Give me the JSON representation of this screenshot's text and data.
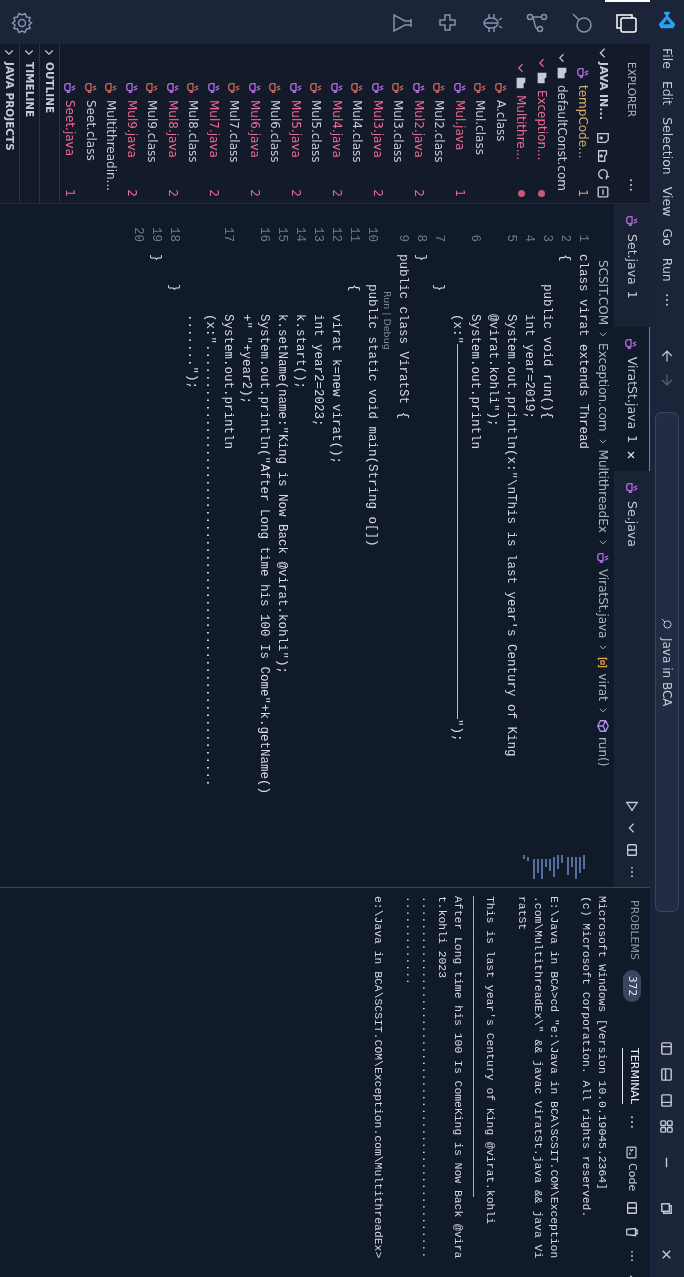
{
  "title_bar": {
    "menu": [
      "File",
      "Edit",
      "Selection",
      "View",
      "Go",
      "Run"
    ],
    "search": "Java in BCA"
  },
  "activity_bar": [
    {
      "kind": "explorer",
      "selected": true
    },
    {
      "kind": "search",
      "selected": false
    },
    {
      "kind": "source_control",
      "selected": false
    },
    {
      "kind": "debug",
      "selected": false
    },
    {
      "kind": "extensions",
      "selected": false
    },
    {
      "kind": "testing",
      "selected": false
    }
  ],
  "sidebar": {
    "title": "EXPLORER",
    "folder": "JAVA IN...",
    "items": [
      {
        "label": "tempCode...",
        "kind": "java",
        "badge": "1",
        "warning": true
      },
      {
        "label": "defaultConst.com",
        "kind": "folder",
        "expanded": true,
        "children": [
          {
            "label": "Exception...",
            "kind": "folder",
            "expanded": true,
            "error": true,
            "children": [
              {
                "label": "Multithre...",
                "kind": "folder",
                "expanded": true,
                "error": true,
                "children": [
                  {
                    "label": "A.class",
                    "kind": "class"
                  },
                  {
                    "label": "Mul.class",
                    "kind": "class"
                  },
                  {
                    "label": "Mul.java",
                    "kind": "java",
                    "badge": "1",
                    "error": true
                  },
                  {
                    "label": "Mul2.class",
                    "kind": "class"
                  },
                  {
                    "label": "Mul2.java",
                    "kind": "java",
                    "badge": "2",
                    "error": true
                  },
                  {
                    "label": "Mul3.class",
                    "kind": "class"
                  },
                  {
                    "label": "Mul3.java",
                    "kind": "java",
                    "badge": "2",
                    "error": true
                  },
                  {
                    "label": "Mul4.class",
                    "kind": "class"
                  },
                  {
                    "label": "Mul4.java",
                    "kind": "java",
                    "badge": "2",
                    "error": true
                  },
                  {
                    "label": "Mul5.class",
                    "kind": "class"
                  },
                  {
                    "label": "Mul5.java",
                    "kind": "java",
                    "badge": "2",
                    "error": true
                  },
                  {
                    "label": "Mul6.class",
                    "kind": "class"
                  },
                  {
                    "label": "Mul6.java",
                    "kind": "java",
                    "badge": "2",
                    "error": true
                  },
                  {
                    "label": "Mul7.class",
                    "kind": "class"
                  },
                  {
                    "label": "Mul7.java",
                    "kind": "java",
                    "badge": "2",
                    "error": true
                  },
                  {
                    "label": "Mul8.class",
                    "kind": "class"
                  },
                  {
                    "label": "Mul8.java",
                    "kind": "java",
                    "badge": "2",
                    "error": true
                  },
                  {
                    "label": "Mul9.class",
                    "kind": "class"
                  },
                  {
                    "label": "Mul9.java",
                    "kind": "java",
                    "badge": "2",
                    "error": true
                  },
                  {
                    "label": "Multithreadin...",
                    "kind": "class"
                  },
                  {
                    "label": "Seet.class",
                    "kind": "class"
                  },
                  {
                    "label": "Seet.java",
                    "kind": "java",
                    "badge": "1",
                    "error": true
                  }
                ]
              }
            ]
          }
        ]
      }
    ],
    "sections": [
      {
        "label": "OUTLINE",
        "expanded": false
      },
      {
        "label": "TIMELINE",
        "expanded": false
      },
      {
        "label": "JAVA PROJECTS",
        "expanded": false
      }
    ]
  },
  "editor": {
    "tabs": [
      {
        "label": "Set.java",
        "badge": "1",
        "error": true,
        "selected": false
      },
      {
        "label": "ViratSt.java",
        "badge": "1",
        "error": true,
        "selected": true
      },
      {
        "label": "Se.java",
        "selected": false
      }
    ],
    "breadcrumb": [
      {
        "label": "SCSIT.COM",
        "kind": "folder"
      },
      {
        "label": "Exception.com",
        "kind": "folder"
      },
      {
        "label": "MultithreadEx",
        "kind": "folder"
      },
      {
        "label": "ViratSt.java",
        "kind": "java"
      },
      {
        "label": "virat",
        "kind": "class"
      },
      {
        "label": "run()",
        "kind": "method"
      }
    ],
    "lines": [
      {
        "kind": "code",
        "number": "1",
        "text": "class virat extends Thread"
      },
      {
        "kind": "code",
        "number": "2",
        "text": "{"
      },
      {
        "kind": "code",
        "number": "3",
        "text": "    public void run(){"
      },
      {
        "kind": "code",
        "number": "4",
        "text": "        int year=2019;"
      },
      {
        "kind": "code",
        "number": "5",
        "text": "        System.out.println(x:\"\\nThis is last year's Century of King"
      },
      {
        "kind": "wrap",
        "text": "        @virat.kohli\");"
      },
      {
        "kind": "code",
        "number": "6",
        "text": "        System.out.println"
      },
      {
        "kind": "wrap",
        "text": "        (x:\"——————————————————————————————————————————————————\");"
      },
      {
        "kind": "code",
        "number": "7",
        "text": "    }"
      },
      {
        "kind": "code",
        "number": "8",
        "text": "}"
      },
      {
        "kind": "code",
        "number": "9",
        "text": "public class ViratSt {"
      },
      {
        "kind": "codelens",
        "text": "Run | Debug"
      },
      {
        "kind": "code",
        "number": "10",
        "text": "    public static void main(String o[])"
      },
      {
        "kind": "code",
        "number": "11",
        "text": "    {"
      },
      {
        "kind": "code",
        "number": "12",
        "text": "        virat k=new virat();"
      },
      {
        "kind": "code",
        "number": "13",
        "text": "        int year2=2023;"
      },
      {
        "kind": "code",
        "number": "14",
        "text": "        k.start();"
      },
      {
        "kind": "code",
        "number": "15",
        "text": "        k.setName(name:\"King is Now Back @virat.kohli\");"
      },
      {
        "kind": "code",
        "number": "16",
        "text": "        System.out.println(\"After Long time his 100 Is Come\"+k.getName()"
      },
      {
        "kind": "wrap",
        "text": "        +\" \"+year2);"
      },
      {
        "kind": "code",
        "number": "17",
        "text": "        System.out.println"
      },
      {
        "kind": "wrap",
        "text": "        (x:\"..........................................................."
      },
      {
        "kind": "wrap",
        "text": "        .......\");"
      },
      {
        "kind": "code",
        "number": "18",
        "text": "    }"
      },
      {
        "kind": "code",
        "number": "19",
        "text": "}"
      },
      {
        "kind": "code",
        "number": "20"
      }
    ]
  },
  "panel": {
    "tabs": [
      {
        "label": "PROBLEMS",
        "count": "372",
        "selected": false
      },
      {
        "label": "TERMINAL",
        "selected": true
      }
    ],
    "terminal_name": "Code",
    "lines": [
      {
        "text": "Microsoft Windows [Version 10.0.19045.2364]"
      },
      {
        "text": "(c) Microsoft Corporation. All rights reserved."
      },
      {
        "text": "E:\\Java in BCA>cd \"e:\\Java in BCA\\SCSIT.COM\\Exception",
        "spaced": true
      },
      {
        "text": ".com\\MultithreadEx\\\" && javac ViratSt.java && java Vi"
      },
      {
        "text": "ratSt"
      },
      {
        "text": "This is last year's Century of King @virat.kohli",
        "spaced": true
      },
      {
        "text": "————————————————————————————————————————————"
      },
      {
        "text": "After Long time his 100 Is ComeKing is Now Back @vira"
      },
      {
        "text": "t.kohli 2023"
      },
      {
        "text": "....................................................."
      },
      {
        "text": "............."
      },
      {
        "text": "e:\\Java in BCA\\SCSIT.COM\\Exception.com\\MultithreadEx>",
        "spaced": true
      }
    ]
  }
}
